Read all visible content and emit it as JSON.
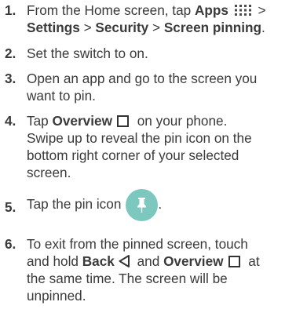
{
  "steps": [
    {
      "num": "1.",
      "lines": [
        {
          "a": "From the Home screen, tap ",
          "b": "Apps",
          "c": " >"
        },
        {
          "a": "Settings",
          "b": " > ",
          "c": "Security",
          "d": " > ",
          "e": "Screen pinning",
          "f": "."
        }
      ]
    },
    {
      "num": "2.",
      "text": "Set the switch to on."
    },
    {
      "num": "3.",
      "line1": "Open an app and go to the screen you",
      "line2": "want to pin."
    },
    {
      "num": "4.",
      "pre": "Tap ",
      "bold": "Overview",
      "post": " on your phone.",
      "line2": "Swipe up to reveal the pin icon on the",
      "line3": "bottom right corner of your selected",
      "line4": "screen."
    },
    {
      "num": "5.",
      "pre": "Tap the pin icon",
      "post": "."
    },
    {
      "num": "6.",
      "line1": "To exit from the pinned screen, touch",
      "l2_pre": "and hold ",
      "l2_back": "Back",
      "l2_and": " and ",
      "l2_overview": "Overview",
      "l2_post": " at",
      "line3": "the same time. The screen will be",
      "line4": "unpinned."
    }
  ],
  "colors": {
    "text": "#3a3a3a",
    "pin_circle": "#7cc8bf"
  },
  "icons": [
    "apps-grid-icon",
    "overview-square-icon",
    "back-triangle-icon",
    "pin-icon"
  ]
}
